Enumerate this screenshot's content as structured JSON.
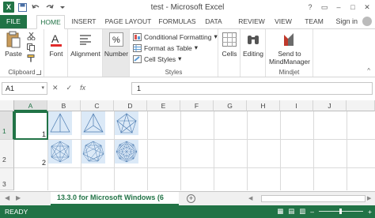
{
  "window": {
    "title": "test - Microsoft Excel",
    "app_icon_label": "X",
    "buttons": [
      "?",
      "▭",
      "–",
      "□",
      "✕"
    ]
  },
  "tabs": [
    "FILE",
    "HOME",
    "INSERT",
    "PAGE LAYOUT",
    "FORMULAS",
    "DATA",
    "REVIEW",
    "VIEW",
    "TEAM"
  ],
  "signin": "Sign in",
  "ribbon": {
    "paste": "Paste",
    "font": "Font",
    "alignment": "Alignment",
    "number": "Number",
    "conditional_formatting": "Conditional Formatting",
    "format_as_table": "Format as Table",
    "cell_styles": "Cell Styles",
    "cells": "Cells",
    "editing": "Editing",
    "send_to_line1": "Send to",
    "send_to_line2": "MindManager",
    "groups": {
      "clipboard": "Clipboard",
      "styles": "Styles",
      "mindjet": "Mindjet"
    }
  },
  "formula_bar": {
    "name_box": "A1",
    "cancel": "✕",
    "enter": "✓",
    "fx": "fx",
    "value": "1"
  },
  "grid": {
    "columns": [
      "A",
      "B",
      "C",
      "D",
      "E",
      "F",
      "G",
      "H",
      "I",
      "J"
    ],
    "rows": [
      "1",
      "2",
      "3"
    ],
    "cells": {
      "A1": "1",
      "A2": "2"
    }
  },
  "sheet": {
    "active_tab": "13.3.0 for Microsoft Windows (6",
    "add": "+"
  },
  "status": {
    "text": "READY",
    "zoom_minus": "–",
    "zoom_plus": "+"
  },
  "colors": {
    "accent": "#217346"
  }
}
